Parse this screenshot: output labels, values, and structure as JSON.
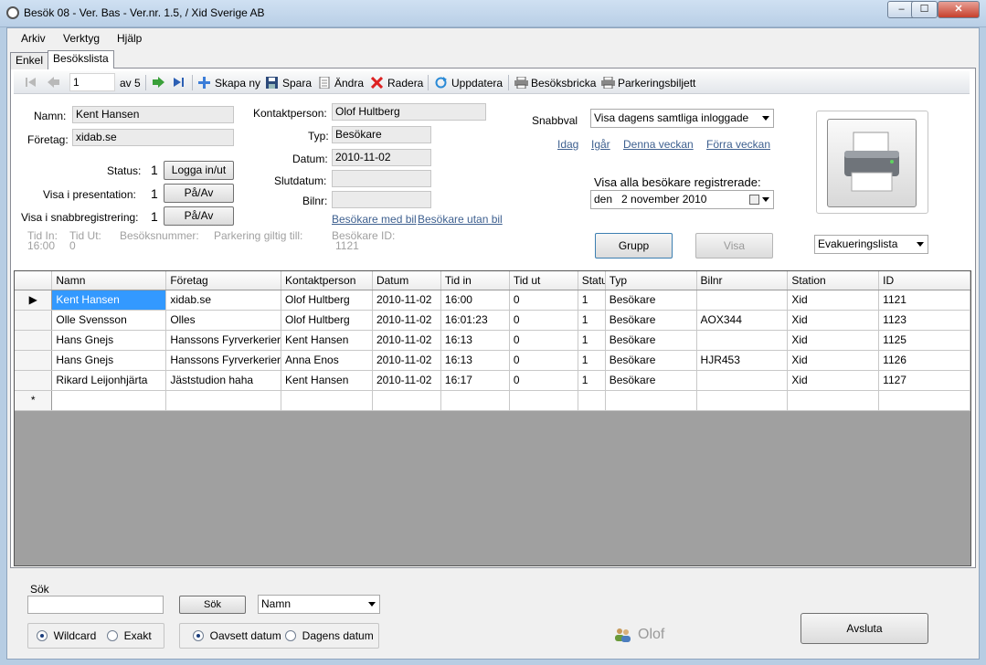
{
  "window": {
    "title": "Besök 08 - Ver. Bas - Ver.nr. 1.5, / Xid Sverige AB",
    "minimize": "‒",
    "maximize": "☐",
    "close": "✕"
  },
  "menu": [
    "Arkiv",
    "Verktyg",
    "Hjälp"
  ],
  "tabs": [
    "Enkel",
    "Besökslista"
  ],
  "toolbar": {
    "position": "1",
    "of": "av 5",
    "new": "Skapa ny",
    "save": "Spara",
    "edit": "Ändra",
    "delete": "Radera",
    "refresh": "Uppdatera",
    "badge": "Besöksbricka",
    "parking": "Parkeringsbiljett"
  },
  "form": {
    "name_label": "Namn:",
    "name": "Kent Hansen",
    "company_label": "Företag:",
    "company": "xidab.se",
    "status_label": "Status:",
    "status": "1",
    "login_button": "Logga in/ut",
    "presentation_label": "Visa i presentation:",
    "presentation": "1",
    "presentation_button": "På/Av",
    "quick_label": "Visa i snabbregistrering:",
    "quick": "1",
    "quick_button": "På/Av",
    "contact_label": "Kontaktperson:",
    "contact": "Olof Hultberg",
    "type_label": "Typ:",
    "type": "Besökare",
    "date_label": "Datum:",
    "date": "2010-11-02",
    "enddate_label": "Slutdatum:",
    "enddate": "",
    "car_label": "Bilnr:",
    "car": "",
    "with_car": "Besökare med bil",
    "without_car": "Besökare utan bil",
    "time_in_label": "Tid In:",
    "time_in": "16:00",
    "time_out_label": "Tid Ut:",
    "time_out": "0",
    "visit_no_label": "Besöksnummer:",
    "parking_label": "Parkering giltig till:",
    "visitor_id_label": "Besökare ID:",
    "visitor_id": "1121"
  },
  "quick": {
    "label": "Snabbval",
    "selected": "Visa dagens samtliga inloggade",
    "today": "Idag",
    "yesterday": "Igår",
    "this_week": "Denna veckan",
    "last_week": "Förra veckan",
    "registered_label": "Visa alla besökare registrerade:",
    "day": "den",
    "date": "2 november 2010",
    "group_button": "Grupp",
    "show_button": "Visa",
    "evac": "Evakueringslista"
  },
  "grid": {
    "columns": [
      "Namn",
      "Företag",
      "Kontaktperson",
      "Datum",
      "Tid in",
      "Tid ut",
      "Status",
      "Typ",
      "Bilnr",
      "Station",
      "ID"
    ],
    "rows": [
      [
        "Kent Hansen",
        "xidab.se",
        "Olof Hultberg",
        "2010-11-02",
        "16:00",
        "0",
        "1",
        "Besökare",
        "",
        "Xid",
        "1121"
      ],
      [
        "Olle Svensson",
        "Olles",
        "Olof Hultberg",
        "2010-11-02",
        "16:01:23",
        "0",
        "1",
        "Besökare",
        "AOX344",
        "Xid",
        "1123"
      ],
      [
        "Hans Gnejs",
        "Hanssons Fyrverkerier",
        "Kent Hansen",
        "2010-11-02",
        "16:13",
        "0",
        "1",
        "Besökare",
        "",
        "Xid",
        "1125"
      ],
      [
        "Hans Gnejs",
        "Hanssons Fyrverkerier",
        "Anna Enos",
        "2010-11-02",
        "16:13",
        "0",
        "1",
        "Besökare",
        "HJR453",
        "Xid",
        "1126"
      ],
      [
        "Rikard Leijonhjärta",
        "Jäststudion haha",
        "Kent Hansen",
        "2010-11-02",
        "16:17",
        "0",
        "1",
        "Besökare",
        "",
        "Xid",
        "1127"
      ]
    ],
    "current_marker": "▶",
    "new_marker": "*"
  },
  "search": {
    "label": "Sök",
    "value": "",
    "button": "Sök",
    "field": "Namn",
    "wildcard": "Wildcard",
    "exact": "Exakt",
    "regardless_date": "Oavsett datum",
    "today_date": "Dagens datum"
  },
  "user": "Olof",
  "exit_button": "Avsluta"
}
